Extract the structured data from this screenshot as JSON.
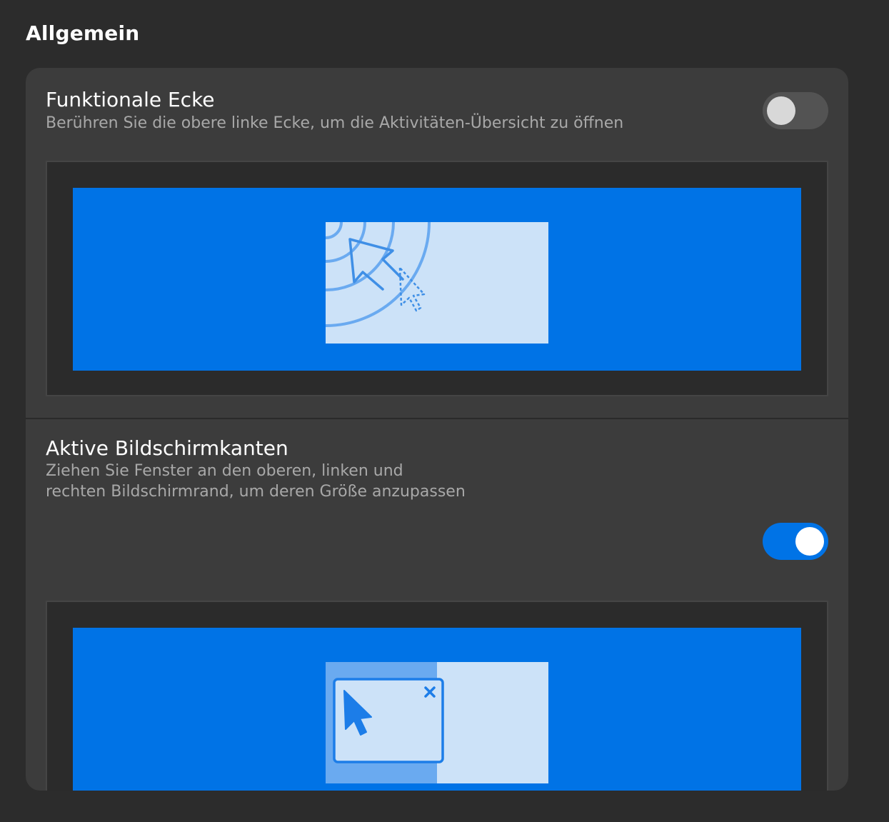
{
  "section": {
    "title": "Allgemein"
  },
  "hot_corner": {
    "title": "Funktionale Ecke",
    "description": "Berühren Sie die obere linke Ecke, um die Aktivitäten-Übersicht zu öffnen",
    "enabled": false
  },
  "active_edges": {
    "title": "Aktive Bildschirmkanten",
    "description_line1": "Ziehen Sie Fenster an den oberen, linken und",
    "description_line2": "rechten Bildschirmrand, um deren Größe anzupassen",
    "enabled": true
  },
  "colors": {
    "accent": "#0073e6",
    "background": "#2c2c2c",
    "card": "#3c3c3c",
    "illustration_light": "#cce2f8",
    "illustration_mid": "#6aaaf0"
  },
  "icons": {
    "hot_corner_illustration": "hot-corner-illustration",
    "edge_tiling_illustration": "edge-tiling-illustration"
  }
}
